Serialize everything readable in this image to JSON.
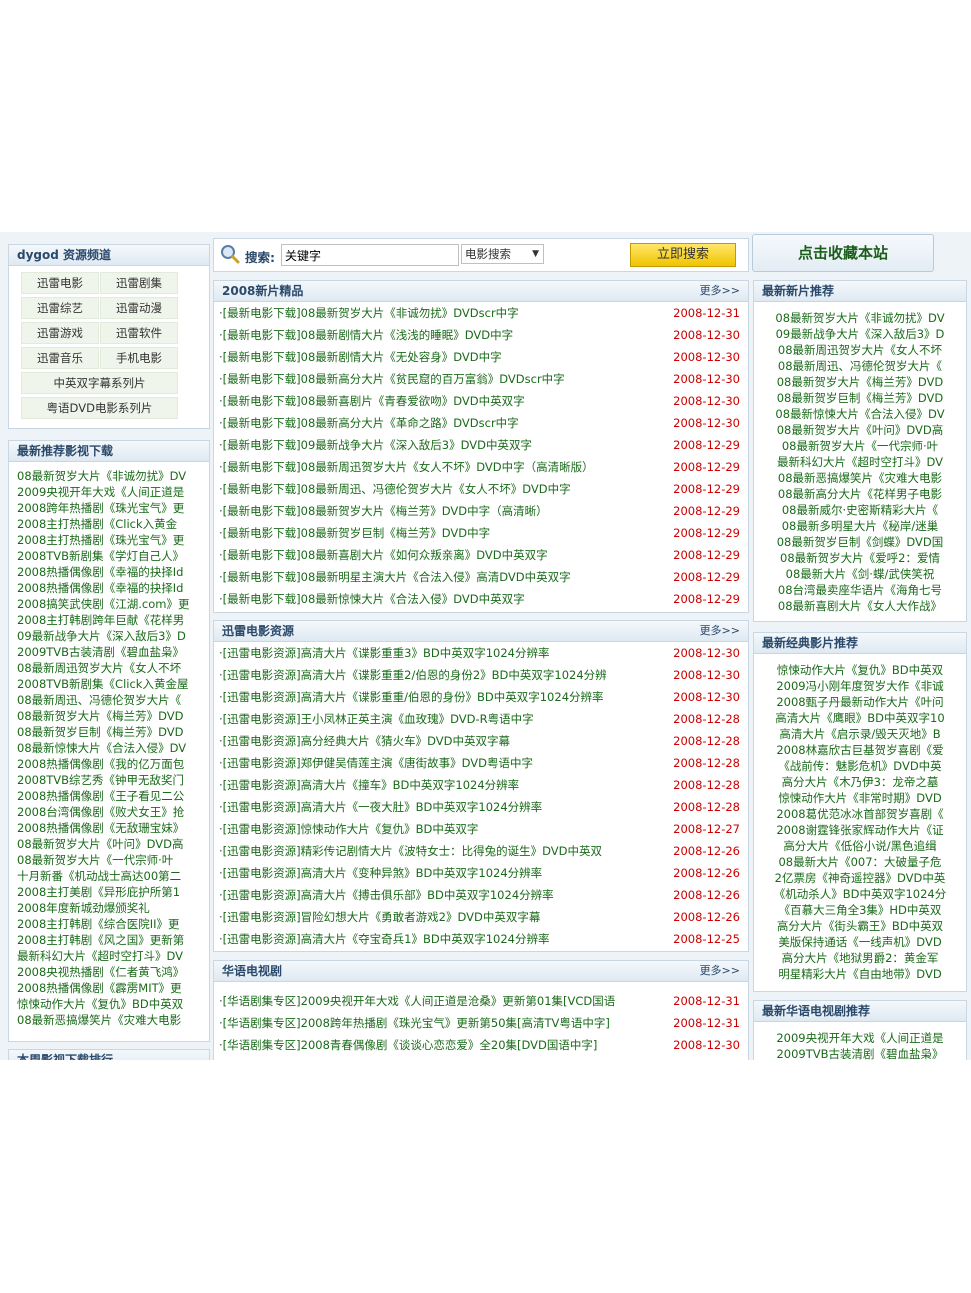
{
  "search": {
    "label": "搜索:",
    "value": "关键字",
    "select": "电影搜索",
    "button": "立即搜索"
  },
  "fav": "点击收藏本站",
  "left": {
    "channel": {
      "title": "dygod 资源频道",
      "items": [
        "迅雷电影",
        "迅雷剧集",
        "迅雷综艺",
        "迅雷动漫",
        "迅雷游戏",
        "迅雷软件",
        "迅雷音乐",
        "手机电影"
      ],
      "wide": [
        "中英双字幕系列片",
        "粤语DVD电影系列片"
      ]
    },
    "recommend": {
      "title": "最新推荐影视下载",
      "items": [
        "08最新贺岁大片《非诚勿扰》DV",
        "2009央视开年大戏《人间正道是",
        "2008跨年热播剧《珠光宝气》更",
        "2008主打热播剧《Click入黄金",
        "2008主打热播剧《珠光宝气》更",
        "2008TVB新剧集《学灯自己人》",
        "2008热播偶像剧《幸福的抉择Id",
        "2008热播偶像剧《幸福的抉择Id",
        "2008搞笑武侠剧《江湖.com》更",
        "2008主打韩剧跨年巨献《花样男",
        "09最新战争大片《深入敌后3》D",
        "2009TVB古装清剧《碧血盐枭》",
        "08最新周迅贺岁大片《女人不坏",
        "2008TVB新剧集《Click入黄金屋",
        "08最新周迅、冯德伦贺岁大片《",
        "08最新贺岁大片《梅兰芳》DVD",
        "08最新贺岁巨制《梅兰芳》DVD",
        "08最新惊悚大片《合法入侵》DV",
        "2008热播偶像剧《我的亿万面包",
        "2008TVB综艺秀《钟甲无敌奖门",
        "2008热播偶像剧《王子看见二公",
        "2008台湾偶像剧《败犬女王》抢",
        "2008热播偶像剧《无敌珊宝妹》",
        "08最新贺岁大片《叶问》DVD高",
        "08最新贺岁大片《一代宗师·叶",
        "十月新番《机动战士高达00第二",
        "2008主打美剧《异形庇护所第1",
        "2008年度新城劲爆颁奖礼",
        "2008主打韩剧《综合医院II》更",
        "2008主打韩剧《风之国》更新第",
        "最新科幻大片《超时空打斗》DV",
        "2008央视热播剧《仁者黄飞鸿》",
        "2008热播偶像剧《霹雳MIT》更",
        "惊悚动作大片《复仇》BD中英双",
        "08最新恶搞爆笑片《灾难大电影"
      ]
    },
    "rank_title": "本周影视下载排行"
  },
  "mid": {
    "s1": {
      "title": "2008新片精品",
      "more": "更多>>",
      "rows": [
        [
          "·[最新电影下载]08最新贺岁大片《非诚勿扰》DVDscr中字",
          "2008-12-31"
        ],
        [
          "·[最新电影下载]08最新剧情大片《浅浅的睡眠》DVD中字",
          "2008-12-30"
        ],
        [
          "·[最新电影下载]08最新剧情大片《无处容身》DVD中字",
          "2008-12-30"
        ],
        [
          "·[最新电影下载]08最新高分大片《贫民窟的百万富翁》DVDscr中字",
          "2008-12-30"
        ],
        [
          "·[最新电影下载]08最新喜剧片《青春爱欲吻》DVD中英双字",
          "2008-12-30"
        ],
        [
          "·[最新电影下载]08最新高分大片《革命之路》DVDscr中字",
          "2008-12-30"
        ],
        [
          "·[最新电影下载]09最新战争大片《深入敌后3》DVD中英双字",
          "2008-12-29"
        ],
        [
          "·[最新电影下载]08最新周迅贺岁大片《女人不坏》DVD中字（高清晰版）",
          "2008-12-29"
        ],
        [
          "·[最新电影下载]08最新周迅、冯德伦贺岁大片《女人不坏》DVD中字",
          "2008-12-29"
        ],
        [
          "·[最新电影下载]08最新贺岁大片《梅兰芳》DVD中字（高清晰）",
          "2008-12-29"
        ],
        [
          "·[最新电影下载]08最新贺岁巨制《梅兰芳》DVD中字",
          "2008-12-29"
        ],
        [
          "·[最新电影下载]08最新喜剧大片《如何众叛亲离》DVD中英双字",
          "2008-12-29"
        ],
        [
          "·[最新电影下载]08最新明星主演大片《合法入侵》高清DVD中英双字",
          "2008-12-29"
        ],
        [
          "·[最新电影下载]08最新惊悚大片《合法入侵》DVD中英双字",
          "2008-12-29"
        ]
      ]
    },
    "s2": {
      "title": "迅雷电影资源",
      "more": "更多>>",
      "rows": [
        [
          "·[迅雷电影资源]高清大片《谍影重重3》BD中英双字1024分辨率",
          "2008-12-30"
        ],
        [
          "·[迅雷电影资源]高清大片《谍影重重2/伯恩的身份2》BD中英双字1024分辨",
          "2008-12-30"
        ],
        [
          "·[迅雷电影资源]高清大片《谍影重重/伯恩的身份》BD中英双字1024分辨率",
          "2008-12-30"
        ],
        [
          "·[迅雷电影资源]王小凤林正英主演《血玫瑰》DVD-R粤语中字",
          "2008-12-28"
        ],
        [
          "·[迅雷电影资源]高分经典大片《猜火车》DVD中英双字幕",
          "2008-12-28"
        ],
        [
          "·[迅雷电影资源]郑伊健吴倩莲主演《唐街故事》DVD粤语中字",
          "2008-12-28"
        ],
        [
          "·[迅雷电影资源]高清大片《撞车》BD中英双字1024分辨率",
          "2008-12-28"
        ],
        [
          "·[迅雷电影资源]高清大片《一夜大肚》BD中英双字1024分辨率",
          "2008-12-28"
        ],
        [
          "·[迅雷电影资源]惊悚动作大片《复仇》BD中英双字",
          "2008-12-27"
        ],
        [
          "·[迅雷电影资源]精彩传记剧情大片《波特女士：比得兔的诞生》DVD中英双",
          "2008-12-26"
        ],
        [
          "·[迅雷电影资源]高清大片《变种异煞》BD中英双字1024分辨率",
          "2008-12-26"
        ],
        [
          "·[迅雷电影资源]高清大片《搏击俱乐部》BD中英双字1024分辨率",
          "2008-12-26"
        ],
        [
          "·[迅雷电影资源]冒险幻想大片《勇敢者游戏2》DVD中英双字幕",
          "2008-12-26"
        ],
        [
          "·[迅雷电影资源]高清大片《夺宝奇兵1》BD中英双字1024分辨率",
          "2008-12-25"
        ]
      ]
    },
    "s3": {
      "title": "华语电视剧",
      "more": "更多>>",
      "rows": [
        [
          "·[华语剧集专区]2009央视开年大戏《人间正道是沧桑》更新第01集[VCD国语",
          "2008-12-31"
        ],
        [
          "·[华语剧集专区]2008跨年热播剧《珠光宝气》更新第50集[高清TV粤语中字]",
          "2008-12-31"
        ],
        [
          "·[华语剧集专区]2008青春偶像剧《谈谈心恋恋爱》全20集[DVD国语中字]",
          "2008-12-30"
        ]
      ]
    }
  },
  "right": {
    "r1": {
      "title": "最新新片推荐",
      "items": [
        "08最新贺岁大片《非诚勿扰》DV",
        "09最新战争大片《深入敌后3》D",
        "08最新周迅贺岁大片《女人不坏",
        "08最新周迅、冯德伦贺岁大片《",
        "08最新贺岁大片《梅兰芳》DVD",
        "08最新贺岁巨制《梅兰芳》DVD",
        "08最新惊悚大片《合法入侵》DV",
        "08最新贺岁大片《叶问》DVD高",
        "08最新贺岁大片《一代宗师·叶",
        "最新科幻大片《超时空打斗》DV",
        "08最新恶搞爆笑片《灾难大电影",
        "08最新高分大片《花样男子电影",
        "08最新威尔·史密斯精彩大片《",
        "08最新多明星大片《秘岸/迷巢",
        "08最新贺岁巨制《剑蝶》DVD国",
        "08最新贺岁大片《爱呼2：爱情",
        "08最新大片《剑·蝶/武侠笑祝",
        "08台湾最卖座华语片《海角七号",
        "08最新喜剧大片《女人大作战》"
      ]
    },
    "r2": {
      "title": "最新经典影片推荐",
      "items": [
        "惊悚动作大片《复仇》BD中英双",
        "2009冯小刚年度贺岁大作《非诚",
        "2008甄子丹最新动作大片《叶问",
        "高清大片《鹰眼》BD中英双字10",
        "高清大片《启示录/毁天灭地》B",
        "2008林嘉欣古巨基贺岁喜剧《爱",
        "《战前传：魅影危机》DVD中英",
        "高分大片《木乃伊3：龙帝之墓",
        "惊悚动作大片《非常时期》DVD",
        "2008葛优范冰冰首部贺岁喜剧《",
        "2008谢霆锋张家辉动作大片《证",
        "高分大片《低俗小说/黑色追缉",
        "08最新大片《007：大破量子危",
        "2亿票房《神奇遥控器》DVD中英",
        "《机动杀人》BD中英双字1024分",
        "《百慕大三角全3集》HD中英双",
        "高分大片《街头霸王》BD中英双",
        "美版保持通话《一线声机》DVD",
        "高分大片《地狱男爵2：黄金军",
        "明星精彩大片《自由地带》DVD"
      ]
    },
    "r3": {
      "title": "最新华语电视剧推荐",
      "items": [
        "2009央视开年大戏《人间正道是",
        "2009TVB古装清剧《碧血盐枭》"
      ]
    }
  }
}
